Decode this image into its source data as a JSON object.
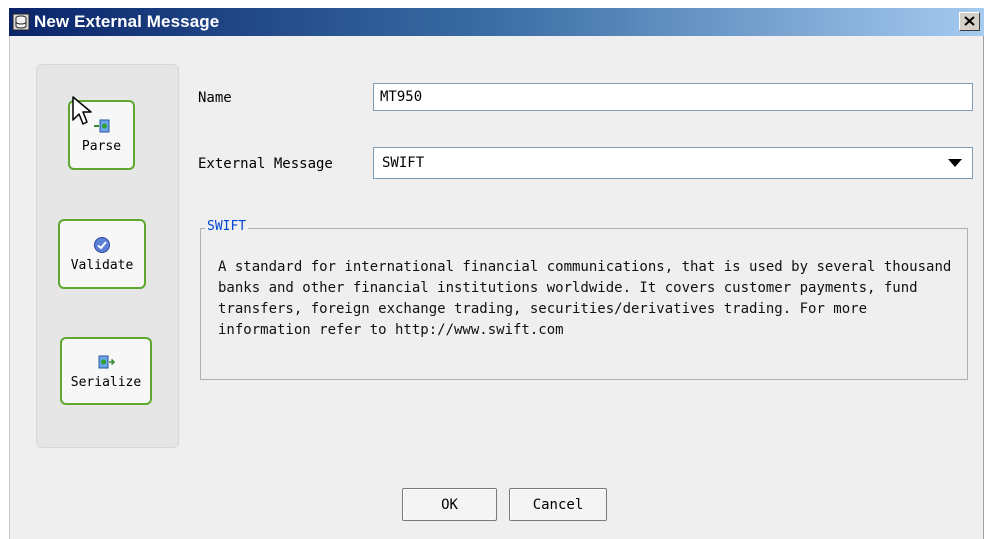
{
  "window": {
    "title": "New External Message",
    "close_icon": "close-icon",
    "title_icon": "database-icon"
  },
  "side_actions": [
    {
      "label": "Parse",
      "icon": "parse-icon"
    },
    {
      "label": "Validate",
      "icon": "validate-check-icon"
    },
    {
      "label": "Serialize",
      "icon": "serialize-icon"
    }
  ],
  "form": {
    "name_label": "Name",
    "name_value": "MT950",
    "external_message_label": "External Message",
    "external_message_value": "SWIFT"
  },
  "description": {
    "legend": "SWIFT",
    "text": "A standard for international financial communications, that is used by several thousand banks and other financial institutions worldwide. It covers customer payments, fund transfers, foreign exchange trading, securities/derivatives trading. For more information refer to http://www.swift.com"
  },
  "buttons": {
    "ok": "OK",
    "cancel": "Cancel"
  },
  "colors": {
    "title_gradient_start": "#0a246a",
    "action_border": "#5fa82f",
    "legend_text": "#0046d5"
  }
}
